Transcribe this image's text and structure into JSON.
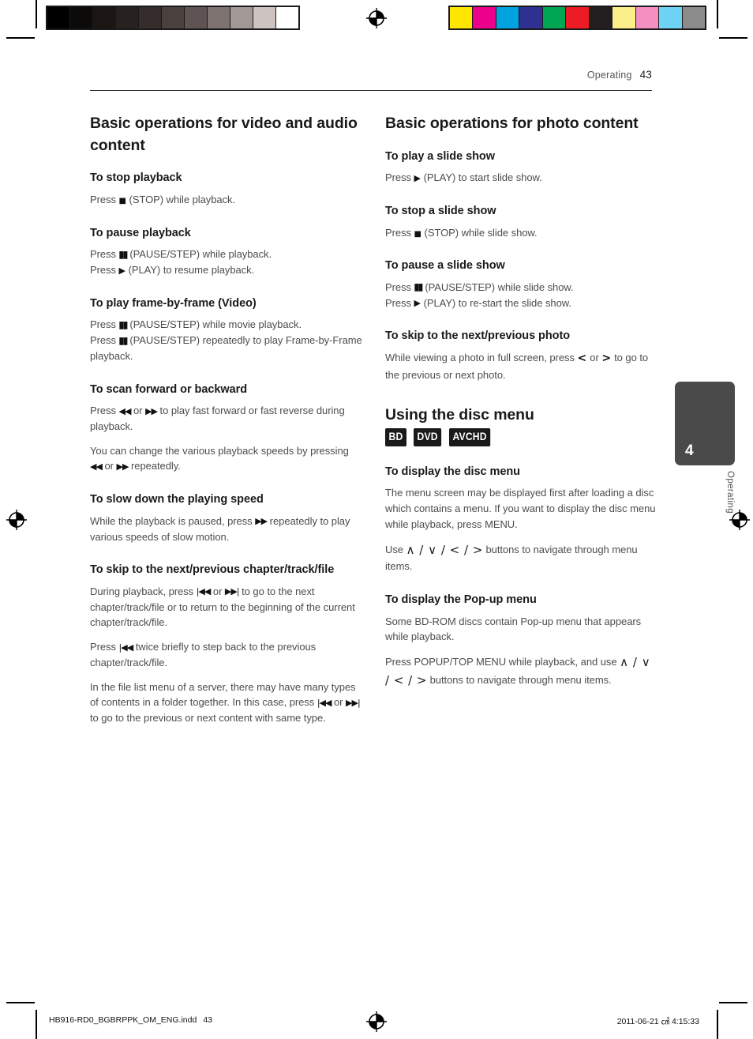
{
  "header": {
    "section": "Operating",
    "page_number": "43"
  },
  "calibration": {
    "grayscale_swatches": [
      "#000000",
      "#0d0a0a",
      "#1b1614",
      "#27211f",
      "#352d2b",
      "#4a403e",
      "#5f5453",
      "#7e7371",
      "#a29896",
      "#cdc3c1",
      "#ffffff"
    ],
    "color_swatches": [
      "#ffe600",
      "#ec008c",
      "#00a3e0",
      "#2e3192",
      "#00a651",
      "#ed1c24",
      "#231f20",
      "#fbef8a",
      "#f490c0",
      "#6fd3f5",
      "#8c8c8c"
    ]
  },
  "left_column": {
    "title": "Basic operations for video and audio content",
    "sections": [
      {
        "heading": "To stop playback",
        "paragraphs": [
          [
            {
              "t": "Press "
            },
            {
              "g": "stop-icon",
              "c": "■"
            },
            {
              "t": " (STOP) while playback."
            }
          ]
        ]
      },
      {
        "heading": "To pause playback",
        "paragraphs": [
          [
            {
              "t": "Press "
            },
            {
              "g": "pause-icon",
              "c": "▮▮"
            },
            {
              "t": " (PAUSE/STEP) while playback."
            },
            {
              "br": true
            },
            {
              "t": "Press "
            },
            {
              "g": "play-icon",
              "c": "▶"
            },
            {
              "t": " (PLAY) to resume playback."
            }
          ]
        ]
      },
      {
        "heading": "To play frame-by-frame (Video)",
        "paragraphs": [
          [
            {
              "t": "Press "
            },
            {
              "g": "pause-icon",
              "c": "▮▮"
            },
            {
              "t": " (PAUSE/STEP) while movie playback."
            },
            {
              "br": true
            },
            {
              "t": "Press "
            },
            {
              "g": "pause-icon",
              "c": "▮▮"
            },
            {
              "t": " (PAUSE/STEP) repeatedly to play Frame-by-Frame playback."
            }
          ]
        ]
      },
      {
        "heading": "To scan forward or backward",
        "paragraphs": [
          [
            {
              "t": "Press "
            },
            {
              "g": "rewind-icon",
              "c": "◀◀"
            },
            {
              "t": " or "
            },
            {
              "g": "fast-forward-icon",
              "c": "▶▶"
            },
            {
              "t": " to play fast forward or fast reverse during playback."
            }
          ],
          [
            {
              "t": "You can change the various playback speeds by pressing "
            },
            {
              "g": "rewind-icon",
              "c": "◀◀"
            },
            {
              "t": " or "
            },
            {
              "g": "fast-forward-icon",
              "c": "▶▶"
            },
            {
              "t": " repeatedly."
            }
          ]
        ]
      },
      {
        "heading": "To slow down the playing speed",
        "paragraphs": [
          [
            {
              "t": "While the playback is paused, press "
            },
            {
              "g": "fast-forward-icon",
              "c": "▶▶"
            },
            {
              "t": " repeatedly to play various speeds of slow motion."
            }
          ]
        ]
      },
      {
        "heading": "To skip to the next/previous chapter/track/file",
        "paragraphs": [
          [
            {
              "t": "During playback, press "
            },
            {
              "g": "skip-previous-icon",
              "c": "|◀◀"
            },
            {
              "t": " or "
            },
            {
              "g": "skip-next-icon",
              "c": "▶▶|"
            },
            {
              "t": " to go to the next chapter/track/file or to return to the beginning of the current chapter/track/file."
            }
          ],
          [
            {
              "t": "Press "
            },
            {
              "g": "skip-previous-icon",
              "c": "|◀◀"
            },
            {
              "t": " twice briefly to step back to the previous chapter/track/file."
            }
          ],
          [
            {
              "t": "In the file list menu of a server, there may have many types of contents in a folder together. In this case, press "
            },
            {
              "g": "skip-previous-icon",
              "c": "|◀◀"
            },
            {
              "t": " or "
            },
            {
              "g": "skip-next-icon",
              "c": "▶▶|"
            },
            {
              "t": " to go to the previous or next content with same type."
            }
          ]
        ]
      }
    ]
  },
  "right_column": {
    "title": "Basic operations for photo content",
    "sections": [
      {
        "heading": "To play a slide show",
        "paragraphs": [
          [
            {
              "t": "Press "
            },
            {
              "g": "play-icon",
              "c": "▶"
            },
            {
              "t": " (PLAY) to start slide show."
            }
          ]
        ]
      },
      {
        "heading": "To stop a slide show",
        "paragraphs": [
          [
            {
              "t": "Press "
            },
            {
              "g": "stop-icon",
              "c": "■"
            },
            {
              "t": " (STOP) while slide show."
            }
          ]
        ]
      },
      {
        "heading": "To pause a slide show",
        "paragraphs": [
          [
            {
              "t": "Press "
            },
            {
              "g": "pause-icon",
              "c": "▮▮"
            },
            {
              "t": " (PAUSE/STEP) while slide show."
            },
            {
              "br": true
            },
            {
              "t": "Press "
            },
            {
              "g": "play-icon",
              "c": "▶"
            },
            {
              "t": " (PLAY) to re-start the slide show."
            }
          ]
        ]
      },
      {
        "heading": "To skip to the next/previous photo",
        "paragraphs": [
          [
            {
              "t": "While viewing a photo in full screen, press "
            },
            {
              "g": "arrow-left-icon",
              "c": "<"
            },
            {
              "t": " or "
            },
            {
              "g": "arrow-right-icon",
              "c": ">"
            },
            {
              "t": " to go to the previous or next photo."
            }
          ]
        ]
      }
    ],
    "title2": "Using the disc menu",
    "badges": [
      "BD",
      "DVD",
      "AVCHD"
    ],
    "sections2": [
      {
        "heading": "To display the disc menu",
        "paragraphs": [
          [
            {
              "t": "The menu screen may be displayed first after loading a disc which contains a menu. If you want to display the disc menu while playback, press MENU."
            }
          ],
          [
            {
              "t": "Use "
            },
            {
              "g": "dpad-icons",
              "c": "∧ / ∨ / < / >"
            },
            {
              "t": " buttons to navigate through menu items."
            }
          ]
        ]
      },
      {
        "heading": "To display the Pop-up menu",
        "paragraphs": [
          [
            {
              "t": "Some BD-ROM discs contain Pop-up menu that appears while playback."
            }
          ],
          [
            {
              "t": "Press POPUP/TOP MENU while playback, and use "
            },
            {
              "g": "dpad-icons",
              "c": "∧ / ∨ / < / >"
            },
            {
              "t": " buttons to navigate through menu items."
            }
          ]
        ]
      }
    ]
  },
  "chapter_tab": {
    "number": "4",
    "label": "Operating",
    "color": "#4a4a4a"
  },
  "footer": {
    "filename": "HB916-RD0_BGBRPPK_OM_ENG.indd",
    "page": "43",
    "timestamp": "2011-06-21   ㎠ 4:15:33"
  }
}
